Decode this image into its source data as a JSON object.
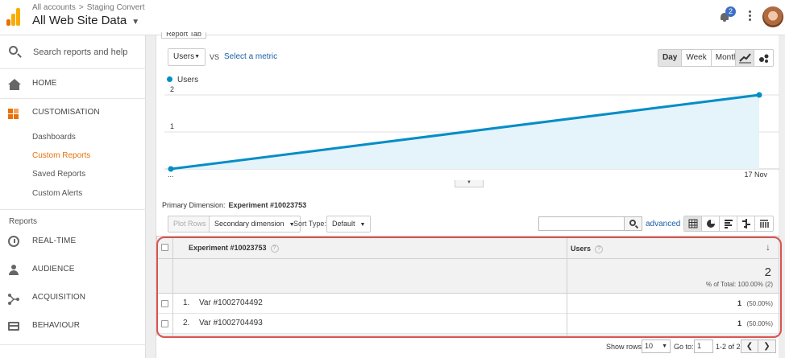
{
  "header": {
    "breadcrumb_account": "All accounts",
    "breadcrumb_property": "Staging Convert",
    "breadcrumb_separator": ">",
    "view_title": "All Web Site Data",
    "notification_count": "2"
  },
  "sidebar": {
    "search_placeholder": "Search reports and help",
    "home": "HOME",
    "customisation": "CUSTOMISATION",
    "customisation_items": [
      "Dashboards",
      "Custom Reports",
      "Saved Reports",
      "Custom Alerts"
    ],
    "active_item": "Custom Reports",
    "reports_section": "Reports",
    "realtime": "REAL-TIME",
    "audience": "AUDIENCE",
    "acquisition": "ACQUISITION",
    "behaviour": "BEHAVIOUR"
  },
  "report": {
    "tab_label": "Report Tab",
    "metric": "Users",
    "vs": "VS",
    "select_metric": "Select a metric",
    "period_buttons": [
      "Day",
      "Week",
      "Month"
    ],
    "active_period": "Day",
    "legend": "Users"
  },
  "chart_data": {
    "type": "area",
    "series": [
      {
        "name": "Users",
        "values": [
          0,
          2
        ]
      }
    ],
    "x_tick_labels": [
      "...",
      "17 Nov"
    ],
    "y_ticks": [
      "1",
      "2"
    ],
    "ylim": [
      0,
      2
    ],
    "line_color": "#058dc7",
    "fill_color": "#e5f3fa"
  },
  "table_controls": {
    "primary_dimension_label": "Primary Dimension:",
    "primary_dimension_value": "Experiment #10023753",
    "plot_rows": "Plot Rows",
    "secondary_dimension": "Secondary dimension",
    "sort_type_label": "Sort Type:",
    "sort_type_value": "Default",
    "advanced": "advanced"
  },
  "table": {
    "col_dimension": "Experiment #10023753",
    "col_metric": "Users",
    "total_value": "2",
    "total_percent": "% of Total: 100.00% (2)",
    "rows": [
      {
        "index": "1.",
        "name": "Var #1002704492",
        "value": "1",
        "pct": "(50.00%)"
      },
      {
        "index": "2.",
        "name": "Var #1002704493",
        "value": "1",
        "pct": "(50.00%)"
      }
    ]
  },
  "footer": {
    "show_rows_label": "Show rows:",
    "show_rows_value": "10",
    "goto_label": "Go to:",
    "goto_value": "1",
    "range": "1-2 of 2"
  }
}
